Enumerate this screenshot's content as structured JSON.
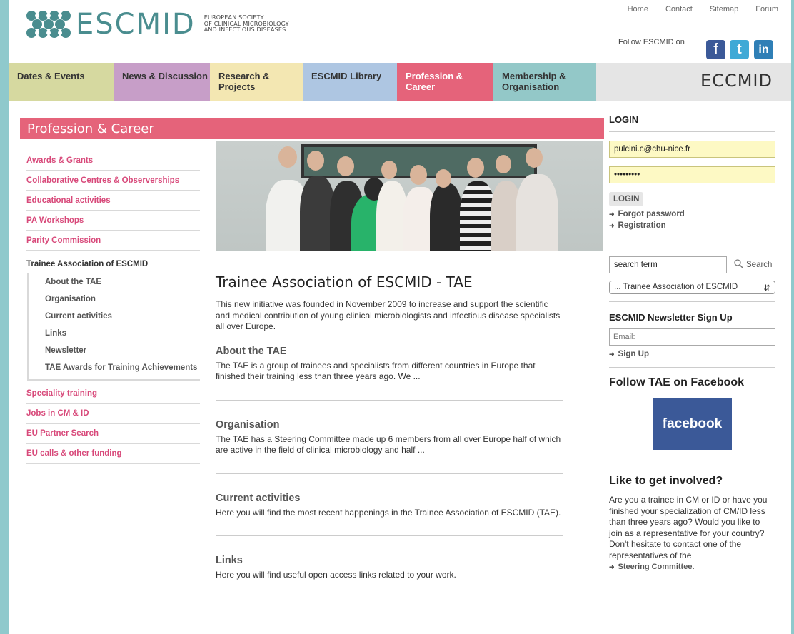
{
  "header": {
    "logo_word": "ESCMID",
    "logo_sub": [
      "EUROPEAN SOCIETY",
      "OF CLINICAL MICROBIOLOGY",
      "AND INFECTIOUS DISEASES"
    ],
    "toplinks": [
      "Home",
      "Contact",
      "Sitemap",
      "Forum"
    ],
    "follow_label": "Follow ESCMID on",
    "social": [
      {
        "icon": "facebook-icon",
        "glyph": "f"
      },
      {
        "icon": "twitter-icon",
        "glyph": "t"
      },
      {
        "icon": "linkedin-icon",
        "glyph": "in"
      }
    ]
  },
  "nav": {
    "items": [
      {
        "label": "Dates & Events",
        "color": "#d6d9a0"
      },
      {
        "label": "News & Discussion",
        "color": "#c79ec8"
      },
      {
        "label": "Research & Projects",
        "color": "#f3e7b2"
      },
      {
        "label": "ESCMID Library",
        "color": "#aec6e2"
      },
      {
        "label": "Profession & Career",
        "color": "#e5637a"
      },
      {
        "label": "Membership & Organisation",
        "color": "#93c8c8"
      }
    ],
    "eccmid": "ECCMID"
  },
  "section_title": "Profession & Career",
  "leftnav": {
    "items_before": [
      "Awards & Grants",
      "Collaborative Centres & Observerships",
      "Educational activities",
      "PA Workshops",
      "Parity Commission"
    ],
    "active": "Trainee Association of ESCMID",
    "sub": [
      "About the TAE",
      "Organisation",
      "Current activities",
      "Links",
      "Newsletter",
      "TAE Awards for Training Achievements"
    ],
    "items_after": [
      "Speciality training",
      "Jobs in CM & ID",
      "EU Partner Search",
      "EU calls & other funding"
    ]
  },
  "main": {
    "title": "Trainee Association of ESCMID - TAE",
    "intro": "This new initiative was founded in November 2009 to increase and support the scientific and medical contribution of young clinical microbiologists and infectious disease specialists all over Europe.",
    "blocks": [
      {
        "title": "About the TAE",
        "text": "The TAE is a group of trainees and specialists from different countries in Europe that finished their training less than three years ago. We ..."
      },
      {
        "title": "Organisation",
        "text": "The TAE has a Steering Committee made up 6 members from all over Europe half of which are active in the field of clinical microbiology and half ..."
      },
      {
        "title": "Current activities",
        "text": "Here you will find the most recent happenings in the Trainee Association of ESCMID (TAE)."
      },
      {
        "title": "Links",
        "text": "Here you will find useful open access links related to your work."
      }
    ]
  },
  "login": {
    "title": "LOGIN",
    "email": "pulcini.c@chu-nice.fr",
    "password": "•••••••••",
    "button": "LOGIN",
    "forgot": "Forgot password",
    "register": "Registration"
  },
  "search": {
    "value": "search term",
    "button": "Search",
    "select": "... Trainee Association of ESCMID"
  },
  "newsletter": {
    "title": "ESCMID Newsletter Sign Up",
    "placeholder": "Email:",
    "signup": "Sign Up"
  },
  "facebook": {
    "title": "Follow TAE on Facebook",
    "badge": "facebook"
  },
  "involved": {
    "title": "Like to get involved?",
    "text": "Are you a trainee in CM or ID or have you finished your specialization of CM/ID less than three years ago? Would you like to join as a representative for your country? Don't hesitate to contact one of the representatives of the",
    "link": "Steering Committee."
  }
}
